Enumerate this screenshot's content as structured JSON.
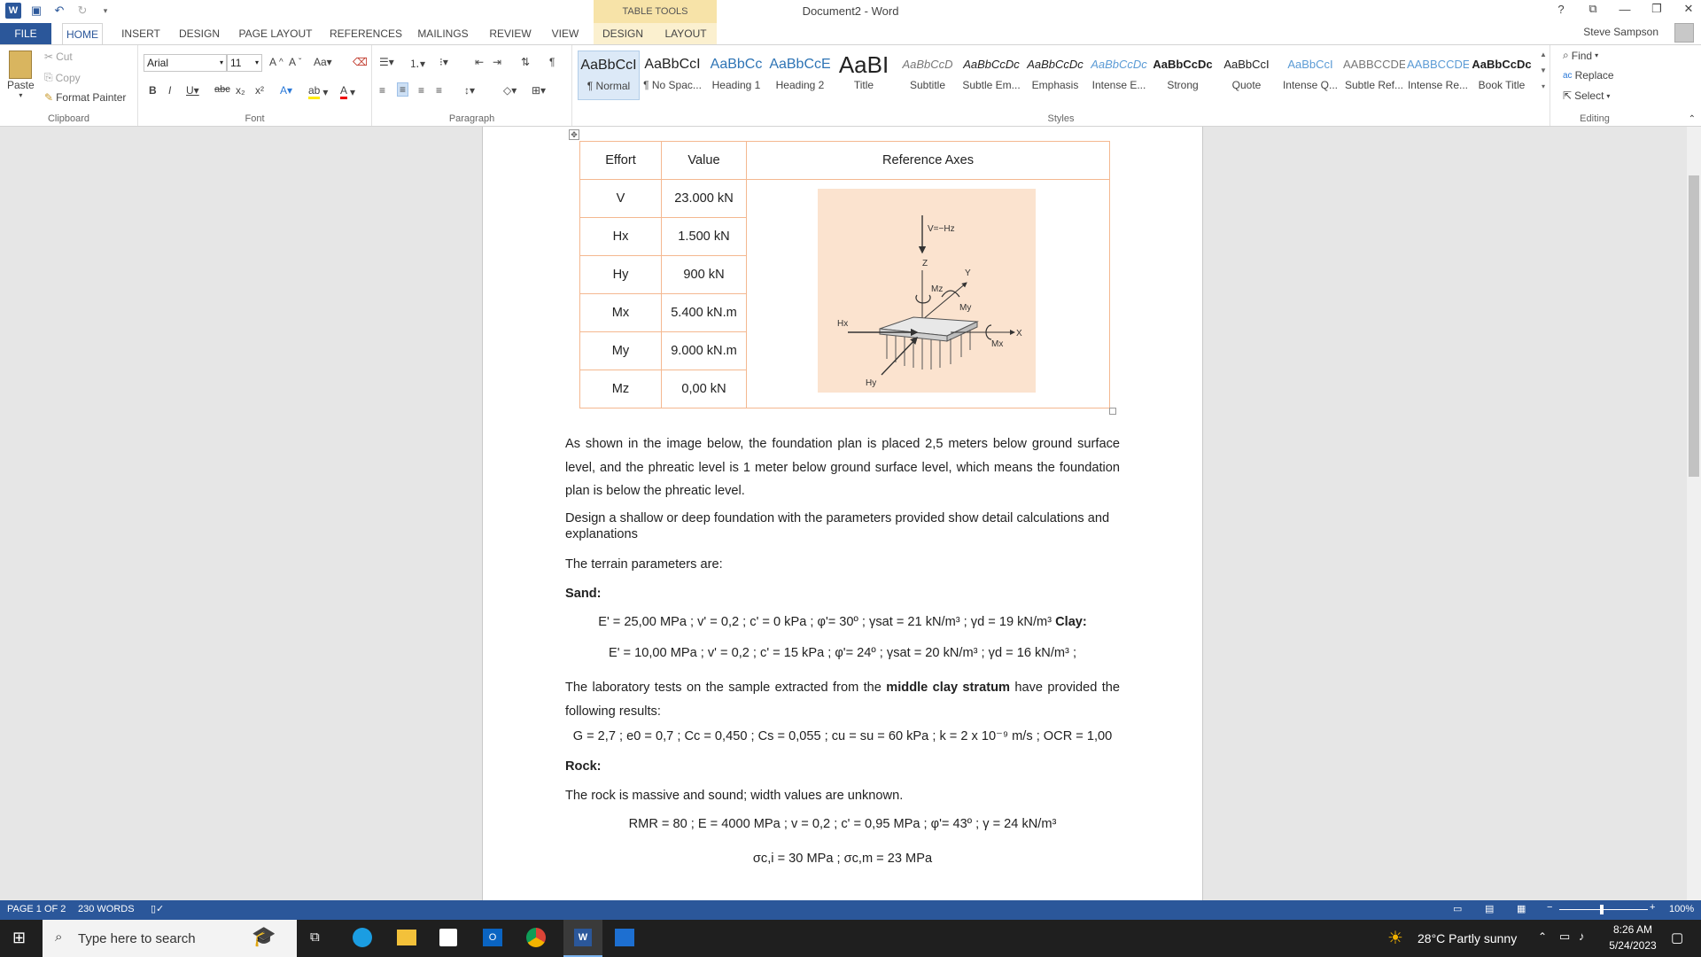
{
  "window": {
    "title": "Document2 - Word",
    "table_tools": "TABLE TOOLS",
    "user": "Steve Sampson"
  },
  "tabs": [
    "FILE",
    "HOME",
    "INSERT",
    "DESIGN",
    "PAGE LAYOUT",
    "REFERENCES",
    "MAILINGS",
    "REVIEW",
    "VIEW",
    "DESIGN",
    "LAYOUT"
  ],
  "clipboard": {
    "paste": "Paste",
    "cut": "Cut",
    "copy": "Copy",
    "format_painter": "Format Painter",
    "label": "Clipboard"
  },
  "font": {
    "name": "Arial",
    "size": "11",
    "label": "Font"
  },
  "paragraph": {
    "label": "Paragraph"
  },
  "styles": {
    "label": "Styles",
    "items": [
      {
        "sample": "AaBbCcI",
        "name": "¶ Normal"
      },
      {
        "sample": "AaBbCcI",
        "name": "¶ No Spac..."
      },
      {
        "sample": "AaBbCc",
        "name": "Heading 1"
      },
      {
        "sample": "AaBbCcE",
        "name": "Heading 2"
      },
      {
        "sample": "AaBI",
        "name": "Title"
      },
      {
        "sample": "AaBbCcD",
        "name": "Subtitle"
      },
      {
        "sample": "AaBbCcDc",
        "name": "Subtle Em..."
      },
      {
        "sample": "AaBbCcDc",
        "name": "Emphasis"
      },
      {
        "sample": "AaBbCcDc",
        "name": "Intense E..."
      },
      {
        "sample": "AaBbCcDc",
        "name": "Strong"
      },
      {
        "sample": "AaBbCcI",
        "name": "Quote"
      },
      {
        "sample": "AaBbCcI",
        "name": "Intense Q..."
      },
      {
        "sample": "AABBCCDE",
        "name": "Subtle Ref..."
      },
      {
        "sample": "AABBCCDE",
        "name": "Intense Re..."
      },
      {
        "sample": "AaBbCcDc",
        "name": "Book Title"
      }
    ]
  },
  "editing": {
    "find": "Find",
    "replace": "Replace",
    "select": "Select",
    "label": "Editing"
  },
  "table": {
    "headers": [
      "Effort",
      "Value",
      "Reference Axes"
    ],
    "rows": [
      [
        "V",
        "23.000 kN"
      ],
      [
        "Hx",
        "1.500 kN"
      ],
      [
        "Hy",
        "900 kN"
      ],
      [
        "Mx",
        "5.400 kN.m"
      ],
      [
        "My",
        "9.000 kN.m"
      ],
      [
        "Mz",
        "0,00 kN"
      ]
    ]
  },
  "figure": {
    "v_label": "V=−Hz",
    "z": "Z",
    "y": "Y",
    "mz": "Mz",
    "my": "My",
    "hx": "Hx",
    "x": "X",
    "mx": "Mx",
    "hy": "Hy"
  },
  "body": {
    "p1": "As shown in the image below, the foundation plan is placed 2,5 meters below ground surface level, and the phreatic level is 1 meter below ground surface level, which means the foundation plan is below the phreatic level.",
    "p2": "Design a shallow or deep foundation with the parameters provided show detail calculations and explanations",
    "p3": "The terrain parameters are:",
    "sand": "Sand:",
    "sand_params": "E' = 25,00 MPa ; v' = 0,2 ; c' = 0 kPa ; φ'= 30º ; γsat = 21 kN/m³ ; γd = 19 kN/m³",
    "clay": "Clay:",
    "clay_params": "E' = 10,00 MPa ; v' = 0,2 ; c' = 15 kPa ; φ'= 24º ; γsat = 20 kN/m³ ; γd = 16 kN/m³ ;",
    "lab1": "The laboratory tests on the sample extracted from the",
    "lab_bold": "middle clay stratum",
    "lab2": "have provided the following results:",
    "lab_params": "G = 2,7 ; e0 = 0,7 ; Cc = 0,450 ; Cs = 0,055 ; cu = su = 60 kPa ; k = 2 x 10⁻⁹ m/s ; OCR = 1,00",
    "rock": "Rock:",
    "rock_text": "The rock is massive and sound; width values are unknown.",
    "rock_params": "RMR = 80 ; E = 4000 MPa ; v = 0,2 ; c' = 0,95 MPa ; φ'= 43º ; γ = 24 kN/m³",
    "sigma": "σc,i = 30 MPa ; σc,m = 23 MPa"
  },
  "status": {
    "page": "PAGE 1 OF 2",
    "words": "230 WORDS",
    "zoom": "100%"
  },
  "taskbar": {
    "search": "Type here to search",
    "weather": "28°C  Partly sunny",
    "time": "8:26 AM",
    "date": "5/24/2023"
  }
}
